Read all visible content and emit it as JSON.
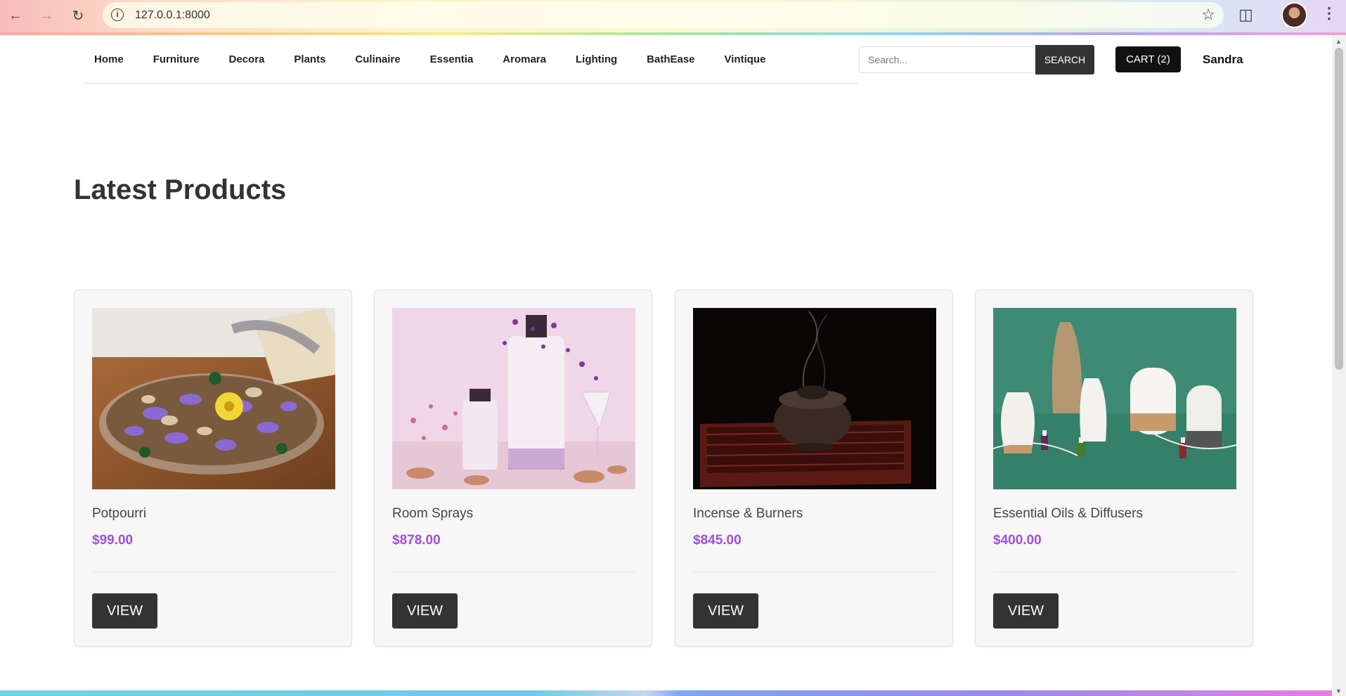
{
  "browser": {
    "url": "127.0.0.1:8000"
  },
  "nav": {
    "items": [
      "Home",
      "Furniture",
      "Decora",
      "Plants",
      "Culinaire",
      "Essentia",
      "Aromara",
      "Lighting",
      "BathEase",
      "Vintique"
    ]
  },
  "search": {
    "placeholder": "Search...",
    "button_label": "SEARCH"
  },
  "cart": {
    "label": "CART (2)"
  },
  "user": {
    "name": "Sandra"
  },
  "main": {
    "title": "Latest Products",
    "products": [
      {
        "name": "Potpourri",
        "price": "$99.00",
        "button": "VIEW"
      },
      {
        "name": "Room Sprays",
        "price": "$878.00",
        "button": "VIEW"
      },
      {
        "name": "Incense & Burners",
        "price": "$845.00",
        "button": "VIEW"
      },
      {
        "name": "Essential Oils & Diffusers",
        "price": "$400.00",
        "button": "VIEW"
      }
    ]
  },
  "colors": {
    "accent_price": "#a050d8",
    "button_dark": "#333333"
  }
}
